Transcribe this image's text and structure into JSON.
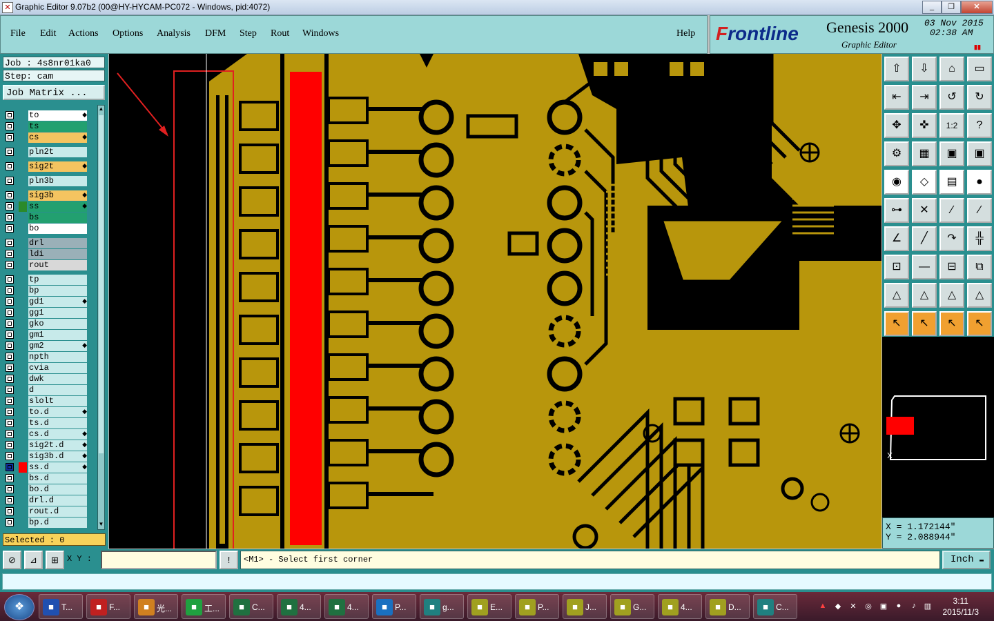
{
  "window": {
    "title": "Graphic Editor 9.07b2 (00@HY-HYCAM-PC072 - Windows, pid:4072)",
    "controls": [
      "_",
      "❐",
      "✕"
    ]
  },
  "menu": [
    "File",
    "Edit",
    "Actions",
    "Options",
    "Analysis",
    "DFM",
    "Step",
    "Rout",
    "Windows"
  ],
  "help_label": "Help",
  "brand": {
    "logo_prefix": "F",
    "logo_rest": "rontline",
    "product": "Genesis 2000",
    "subtitle": "Graphic Editor",
    "date": "03 Nov 2015",
    "time": "02:38 AM"
  },
  "job": {
    "job_line": "Job : 4s8nr01ka0",
    "step_line": "Step: cam",
    "matrix_button": "Job Matrix ..."
  },
  "layers": [
    {
      "name": "to",
      "color": "#ffffff",
      "edit": true
    },
    {
      "name": "ts",
      "color": "#22a070",
      "edit": false
    },
    {
      "name": "cs",
      "color": "#f4c460",
      "edit": true
    },
    {
      "name": "pln2t",
      "color": "#c7eaea",
      "edit": false
    },
    {
      "name": "sig2t",
      "color": "#f4c460",
      "edit": true
    },
    {
      "name": "pln3b",
      "color": "#c7eaea",
      "edit": false
    },
    {
      "name": "sig3b",
      "color": "#f4c460",
      "edit": true
    },
    {
      "name": "ss",
      "color": "#22a070",
      "edit": true,
      "swatch": "#2a8a2a"
    },
    {
      "name": "bs",
      "color": "#22a070",
      "edit": false
    },
    {
      "name": "bo",
      "color": "#ffffff",
      "edit": false
    },
    {
      "name": "drl",
      "color": "#9ab0b8",
      "edit": false
    },
    {
      "name": "ldi",
      "color": "#9ab0b8",
      "edit": false
    },
    {
      "name": "rout",
      "color": "#d8d8d8",
      "edit": false
    },
    {
      "name": "tp",
      "color": "#c7eaea",
      "edit": false
    },
    {
      "name": "bp",
      "color": "#c7eaea",
      "edit": false
    },
    {
      "name": "gd1",
      "color": "#c7eaea",
      "edit": true
    },
    {
      "name": "gg1",
      "color": "#c7eaea",
      "edit": false
    },
    {
      "name": "gko",
      "color": "#c7eaea",
      "edit": false
    },
    {
      "name": "gm1",
      "color": "#c7eaea",
      "edit": false
    },
    {
      "name": "gm2",
      "color": "#c7eaea",
      "edit": true
    },
    {
      "name": "npth",
      "color": "#c7eaea",
      "edit": false
    },
    {
      "name": "cvia",
      "color": "#c7eaea",
      "edit": false
    },
    {
      "name": "dwk",
      "color": "#c7eaea",
      "edit": false
    },
    {
      "name": "d",
      "color": "#c7eaea",
      "edit": false
    },
    {
      "name": "slolt",
      "color": "#c7eaea",
      "edit": false
    },
    {
      "name": "to.d",
      "color": "#c7eaea",
      "edit": true
    },
    {
      "name": "ts.d",
      "color": "#c7eaea",
      "edit": false
    },
    {
      "name": "cs.d",
      "color": "#c7eaea",
      "edit": true
    },
    {
      "name": "sig2t.d",
      "color": "#c7eaea",
      "edit": true
    },
    {
      "name": "sig3b.d",
      "color": "#c7eaea",
      "edit": true
    },
    {
      "name": "ss.d",
      "color": "#c7eaea",
      "edit": true,
      "swatch": "#ff0000",
      "active": true
    },
    {
      "name": "bs.d",
      "color": "#c7eaea",
      "edit": false
    },
    {
      "name": "bo.d",
      "color": "#c7eaea",
      "edit": false
    },
    {
      "name": "drl.d",
      "color": "#c7eaea",
      "edit": false
    },
    {
      "name": "rout.d",
      "color": "#c7eaea",
      "edit": false
    },
    {
      "name": "bp.d",
      "color": "#c7eaea",
      "edit": false
    }
  ],
  "selected_label": "Selected : 0",
  "coords": {
    "x": "X = 1.172144\"",
    "y": "Y = 2.088944\""
  },
  "command": {
    "xy_label": "X Y :",
    "xy_value": "",
    "prompt": "<M1> - Select first corner",
    "unit": "Inch"
  },
  "colors": {
    "copper": "#b8960c",
    "highlight": "#ff0000",
    "panel": "#9cd8d8",
    "board_bg": "#000000"
  },
  "taskbar": {
    "tasks": [
      {
        "icon": "disk-icon",
        "label": "T...",
        "color": "#2050b0"
      },
      {
        "icon": "foxit-icon",
        "label": "F...",
        "color": "#c02020"
      },
      {
        "icon": "shell-icon",
        "label": "光...",
        "color": "#d08020"
      },
      {
        "icon": "app-p-icon",
        "label": "工...",
        "color": "#20a040"
      },
      {
        "icon": "excel-icon",
        "label": "C...",
        "color": "#207040"
      },
      {
        "icon": "excel-icon",
        "label": "4...",
        "color": "#207040"
      },
      {
        "icon": "excel-icon",
        "label": "4...",
        "color": "#207040"
      },
      {
        "icon": "frontline-icon",
        "label": "P...",
        "color": "#1a70c0"
      },
      {
        "icon": "eye-icon",
        "label": "g...",
        "color": "#208080"
      },
      {
        "icon": "genesis-icon",
        "label": "E...",
        "color": "#a0a020"
      },
      {
        "icon": "genesis-icon",
        "label": "P...",
        "color": "#a0a020"
      },
      {
        "icon": "genesis-icon",
        "label": "J...",
        "color": "#a0a020"
      },
      {
        "icon": "genesis-icon",
        "label": "G...",
        "color": "#a0a020"
      },
      {
        "icon": "genesis-icon",
        "label": "4...",
        "color": "#a0a020"
      },
      {
        "icon": "genesis-icon",
        "label": "D...",
        "color": "#a0a020"
      },
      {
        "icon": "eye-icon",
        "label": "C...",
        "color": "#208080"
      }
    ],
    "clock_time": "3:11",
    "clock_date": "2015/11/3"
  }
}
